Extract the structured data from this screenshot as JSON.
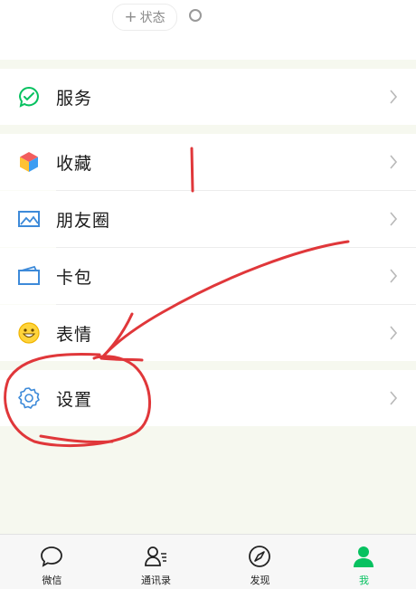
{
  "header": {
    "status_button_label": "状态",
    "status_plus": "+"
  },
  "menu": {
    "items": [
      {
        "label": "服务",
        "icon": "service-icon"
      },
      {
        "label": "收藏",
        "icon": "favorites-icon"
      },
      {
        "label": "朋友圈",
        "icon": "moments-icon"
      },
      {
        "label": "卡包",
        "icon": "card-wallet-icon"
      },
      {
        "label": "表情",
        "icon": "sticker-icon"
      },
      {
        "label": "设置",
        "icon": "settings-icon"
      }
    ]
  },
  "tabbar": {
    "tabs": [
      {
        "label": "微信",
        "icon": "chat-icon",
        "active": false
      },
      {
        "label": "通讯录",
        "icon": "contacts-icon",
        "active": false
      },
      {
        "label": "发现",
        "icon": "discover-icon",
        "active": false
      },
      {
        "label": "我",
        "icon": "me-icon",
        "active": true
      }
    ]
  },
  "colors": {
    "accent": "#07c160",
    "annotation": "#e0373a"
  }
}
